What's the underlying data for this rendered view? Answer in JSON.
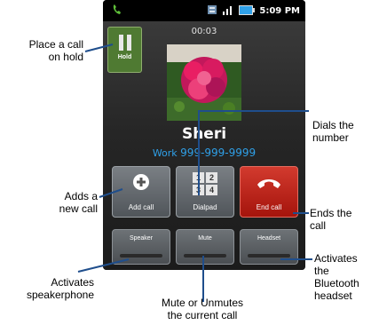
{
  "status_bar": {
    "time": "5:09 PM",
    "icons": [
      "phone-call-icon",
      "sync-icon",
      "signal-icon",
      "battery-icon"
    ]
  },
  "call": {
    "timer": "00:03",
    "contact_name": "Sheri",
    "number_type": "Work",
    "number": "999-999-9999"
  },
  "buttons": {
    "hold": "Hold",
    "add_call": "Add call",
    "dialpad": "Dialpad",
    "end_call": "End call",
    "speaker": "Speaker",
    "mute": "Mute",
    "headset": "Headset"
  },
  "dialpad_digits": [
    "1",
    "2",
    "3",
    "4"
  ],
  "annotations": {
    "hold": [
      "Place a call",
      "on hold"
    ],
    "dialpad": [
      "Dials the",
      "number"
    ],
    "add_call": [
      "Adds a",
      "new call"
    ],
    "end_call": [
      "Ends the",
      "call"
    ],
    "headset": [
      "Activates",
      "the",
      "Bluetooth",
      "headset"
    ],
    "speaker": [
      "Activates",
      "speakerphone"
    ],
    "mute": [
      "Mute or Unmutes",
      "the current call"
    ]
  },
  "colors": {
    "hold_button": "#4f7a32",
    "end_button": "#b71c12",
    "number_text": "#2fa0e8",
    "callout_line": "#1f4e8c"
  }
}
